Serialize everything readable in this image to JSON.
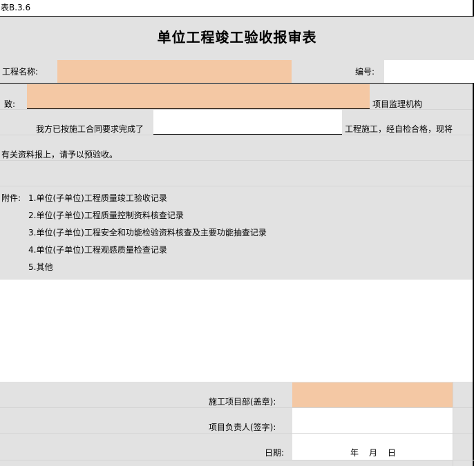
{
  "doc": {
    "table_no": "表B.3.6",
    "title": "单位工程竣工验收报审表"
  },
  "header": {
    "project_name_label": "工程名称:",
    "project_name_value": "",
    "number_label": "编号:",
    "number_value": ""
  },
  "addressee": {
    "label": "致:",
    "value": "",
    "suffix": "项目监理机构"
  },
  "statement": {
    "prefix": "我方已按施工合同要求完成了",
    "value": "",
    "suffix": "工程施工，经自检合格，现将",
    "line2": "有关资料报上，请予以预验收。"
  },
  "attachments": {
    "label": "附件:",
    "items": [
      "1.单位(子单位)工程质量竣工验收记录",
      "2.单位(子单位)工程质量控制资料核查记录",
      "3.单位(子单位)工程安全和功能检验资料核查及主要功能抽查记录",
      "4.单位(子单位)工程观感质量检查记录",
      "5.其他"
    ]
  },
  "signoff": {
    "dept_label": "施工项目部(盖章):",
    "dept_value": "",
    "manager_label": "项目负责人(签字):",
    "manager_value": "",
    "date_label": "日期:",
    "year": "年",
    "month": "月",
    "day": "日"
  }
}
